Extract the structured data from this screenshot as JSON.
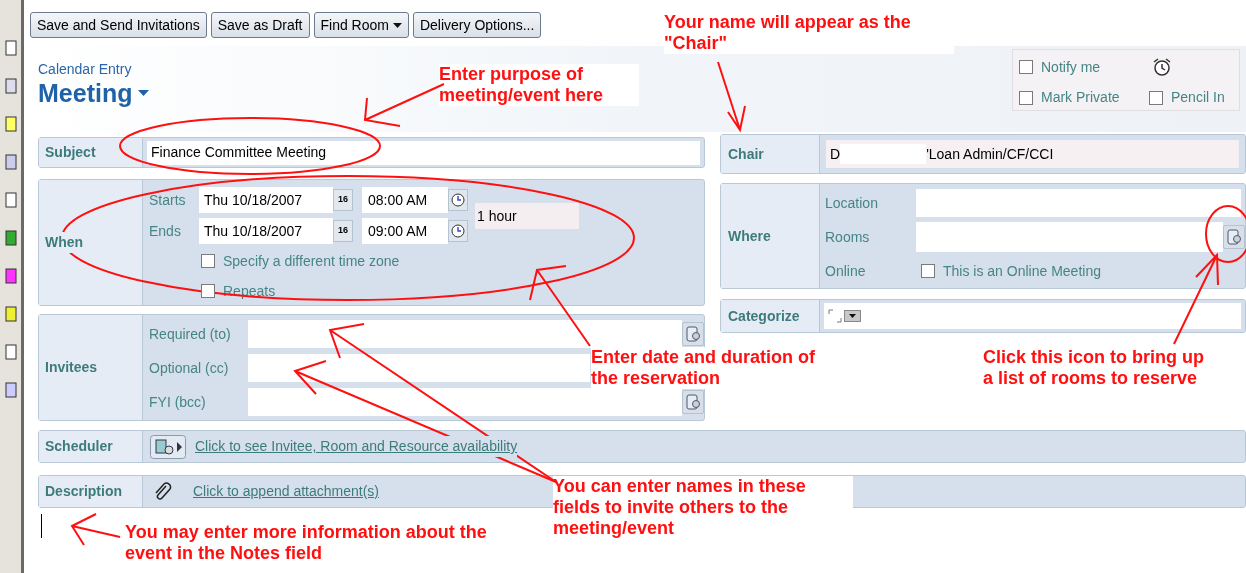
{
  "toolbar": [
    {
      "label": "Save and Send Invitations",
      "kind": "button"
    },
    {
      "label": "Save as Draft",
      "kind": "button"
    },
    {
      "label": "Find Room",
      "kind": "menu"
    },
    {
      "label": "Delivery Options...",
      "kind": "button"
    }
  ],
  "header": {
    "subtitle": "Calendar Entry",
    "title": "Meeting"
  },
  "options": [
    {
      "label": "Notify me",
      "checked": false
    },
    {
      "label": "Mark Private",
      "checked": false
    },
    {
      "label": "Pencil In",
      "checked": false
    }
  ],
  "subject": {
    "label": "Subject",
    "value": "Finance Committee Meeting"
  },
  "when": {
    "label": "When",
    "rows": [
      {
        "label": "Starts",
        "date": "Thu 10/18/2007",
        "date_button": "16",
        "time": "08:00 AM"
      },
      {
        "label": "Ends",
        "date": "Thu 10/18/2007",
        "date_button": "16",
        "time": "09:00 AM"
      }
    ],
    "duration": "1 hour",
    "checkboxes": [
      {
        "label": "Specify a different time zone",
        "checked": false
      },
      {
        "label": "Repeats",
        "checked": false
      }
    ]
  },
  "invitees": {
    "label": "Invitees",
    "fields": [
      {
        "label": "Required (to)",
        "lookup": true
      },
      {
        "label": "Optional (cc)"
      },
      {
        "label": "FYI (bcc)",
        "lookup": true
      }
    ]
  },
  "scheduler": {
    "label": "Scheduler",
    "link": "Click to see Invitee, Room and Resource availability"
  },
  "description": {
    "label": "Description",
    "link": "Click to append attachment(s)"
  },
  "chair": {
    "label": "Chair",
    "value_start": "D",
    "value_end": "'Loan Admin/CF/CCI"
  },
  "where": {
    "label": "Where",
    "fields": [
      {
        "label": "Location",
        "kind": "text"
      },
      {
        "label": "Rooms",
        "kind": "lookup"
      },
      {
        "label": "Online",
        "kind": "checkbox",
        "option": "This is an Online Meeting",
        "checked": false
      }
    ]
  },
  "categorize": {
    "label": "Categorize"
  },
  "annotations": [
    {
      "text": "Your name will appear as the \"Chair\""
    },
    {
      "text": "Enter purpose of meeting/event here"
    },
    {
      "text": "Enter date and duration of the reservation"
    },
    {
      "text": "Click this icon to bring up a list of rooms to reserve"
    },
    {
      "text": "You can enter names in these fields to invite others to the meeting/event"
    },
    {
      "text": "You may enter more information about the event in the Notes field"
    }
  ]
}
